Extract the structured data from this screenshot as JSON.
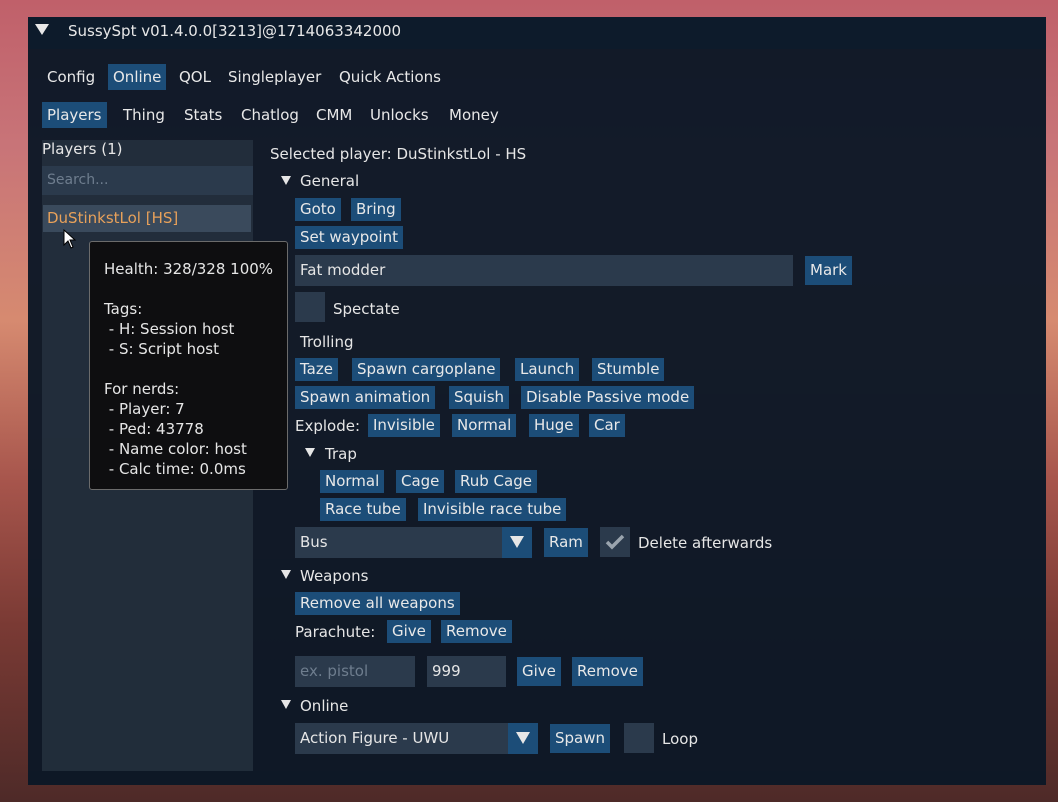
{
  "window": {
    "title": "SussySpt v01.4.0.0[3213]@1714063342000"
  },
  "main_tabs": [
    {
      "label": "Config",
      "active": false
    },
    {
      "label": "Online",
      "active": true
    },
    {
      "label": "QOL",
      "active": false
    },
    {
      "label": "Singleplayer",
      "active": false
    },
    {
      "label": "Quick Actions",
      "active": false
    }
  ],
  "sub_tabs": [
    {
      "label": "Players",
      "active": true
    },
    {
      "label": "Thing",
      "active": false
    },
    {
      "label": "Stats",
      "active": false
    },
    {
      "label": "Chatlog",
      "active": false
    },
    {
      "label": "CMM",
      "active": false
    },
    {
      "label": "Unlocks",
      "active": false
    },
    {
      "label": "Money",
      "active": false
    }
  ],
  "sidebar": {
    "header": "Players (1)",
    "search_placeholder": "Search...",
    "players": [
      "DuStinkstLol [HS]"
    ]
  },
  "tooltip": {
    "text": "Health: 328/328 100%\n\nTags:\n - H: Session host\n - S: Script host\n\nFor nerds:\n - Player: 7\n - Ped: 43778\n - Name color: host\n - Calc time: 0.0ms"
  },
  "details": {
    "selected_label": "Selected player: DuStinkstLol - HS",
    "general": {
      "header": "General",
      "goto": "Goto",
      "bring": "Bring",
      "set_waypoint": "Set waypoint",
      "name_value": "Fat modder",
      "mark": "Mark",
      "spectate": "Spectate"
    },
    "trolling": {
      "header": "Trolling",
      "taze": "Taze",
      "spawn_cargoplane": "Spawn cargoplane",
      "launch": "Launch",
      "stumble": "Stumble",
      "spawn_animation": "Spawn animation",
      "squish": "Squish",
      "disable_passive": "Disable Passive mode",
      "explode_label": "Explode:",
      "explode_invisible": "Invisible",
      "explode_normal": "Normal",
      "explode_huge": "Huge",
      "explode_car": "Car",
      "trap": {
        "header": "Trap",
        "normal": "Normal",
        "cage": "Cage",
        "rub_cage": "Rub Cage",
        "race_tube": "Race tube",
        "invisible_race_tube": "Invisible race tube"
      },
      "vehicle_value": "Bus",
      "ram": "Ram",
      "delete_afterwards": "Delete afterwards",
      "delete_afterwards_checked": true
    },
    "weapons": {
      "header": "Weapons",
      "remove_all": "Remove all weapons",
      "parachute_label": "Parachute:",
      "parachute_give": "Give",
      "parachute_remove": "Remove",
      "weapon_placeholder": "ex. pistol",
      "ammo_value": "999",
      "give": "Give",
      "remove": "Remove"
    },
    "online": {
      "header": "Online",
      "figure_value": "Action Figure - UWU",
      "spawn": "Spawn",
      "loop": "Loop",
      "loop_checked": false
    }
  },
  "colors": {
    "accent": "#1c4d78",
    "panel": "#0c1826",
    "field": "#2b3a4c",
    "player_name": "#e8a15a"
  }
}
